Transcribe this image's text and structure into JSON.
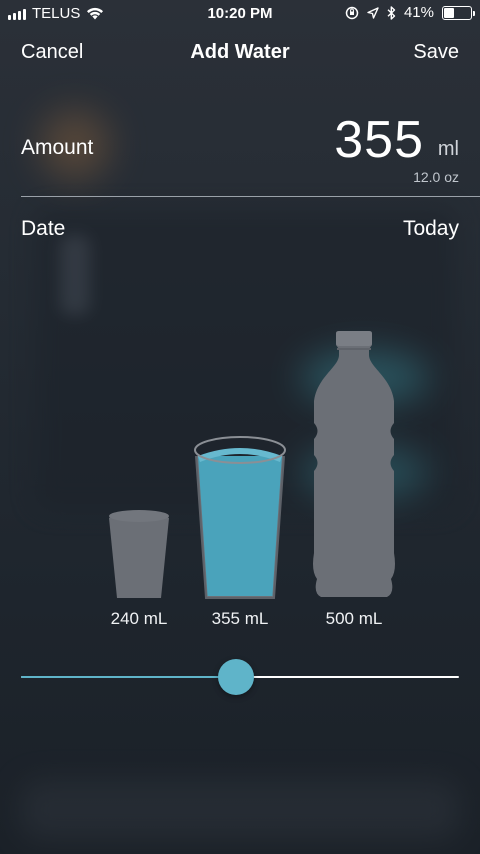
{
  "status_bar": {
    "carrier": "TELUS",
    "time": "10:20 PM",
    "battery_percent": "41%",
    "battery_level": 0.41
  },
  "nav": {
    "cancel_label": "Cancel",
    "title": "Add Water",
    "save_label": "Save"
  },
  "amount": {
    "label": "Amount",
    "value": "355",
    "unit": "ml",
    "secondary": "12.0 oz"
  },
  "date": {
    "label": "Date",
    "value": "Today"
  },
  "containers": [
    {
      "label": "240 mL",
      "icon": "cup-icon",
      "selected": false
    },
    {
      "label": "355 mL",
      "icon": "glass-icon",
      "selected": true
    },
    {
      "label": "500 mL",
      "icon": "bottle-icon",
      "selected": false
    }
  ],
  "slider": {
    "fraction": 0.49
  },
  "colors": {
    "accent": "#5fb4c9",
    "container_fill": "#6b6f76"
  }
}
